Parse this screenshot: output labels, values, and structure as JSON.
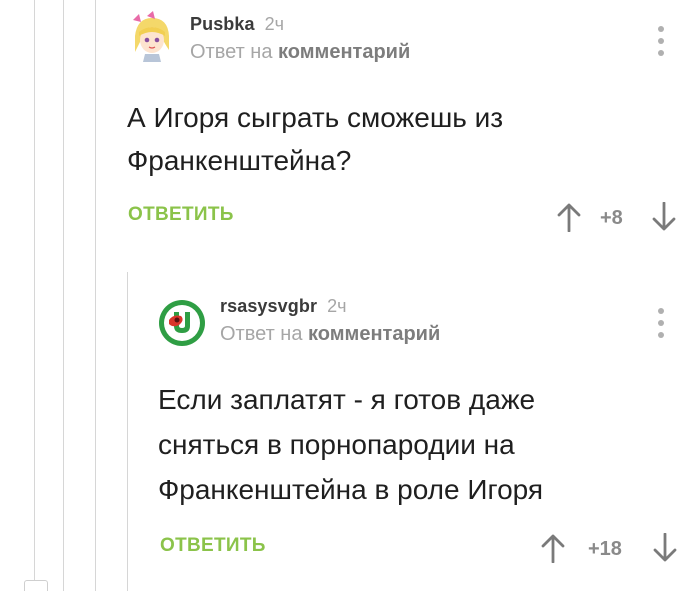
{
  "comments": [
    {
      "username": "Pusbka",
      "time": "2ч",
      "reply_prefix": "Ответ на",
      "reply_link": "комментарий",
      "body_lines": [
        "А Игоря сыграть сможешь из",
        "Франкенштейна?"
      ],
      "reply_label": "ОТВЕТИТЬ",
      "score": "+8"
    },
    {
      "username": "rsasysvgbr",
      "time": "2ч",
      "reply_prefix": "Ответ на",
      "reply_link": "комментарий",
      "body_lines": [
        "Если заплатят - я готов даже",
        "сняться в порнопародии на",
        "Франкенштейна в роле Игоря"
      ],
      "reply_label": "ОТВЕТИТЬ",
      "score": "+18"
    }
  ],
  "colors": {
    "accent_green": "#8bc34a",
    "muted_gray": "#a6a6a6",
    "line_gray": "#d6d6d6"
  },
  "icons": {
    "upvote": "arrow-up-icon",
    "downvote": "arrow-down-icon",
    "menu": "kebab-menu-icon"
  }
}
